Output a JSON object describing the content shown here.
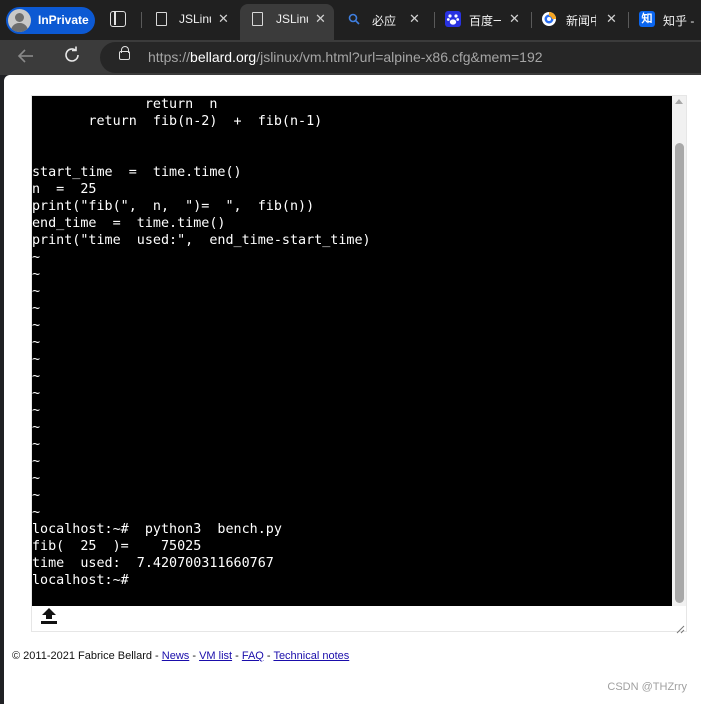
{
  "browser": {
    "inprivate_label": "InPrivate",
    "tabs": [
      {
        "label": "JSLinux",
        "active": false
      },
      {
        "label": "JSLinux",
        "active": true
      },
      {
        "label": "必应",
        "active": false
      },
      {
        "label": "百度一",
        "active": false
      },
      {
        "label": "新闻中",
        "active": false
      },
      {
        "label": "知乎 -",
        "active": false
      }
    ],
    "close_glyph": "✕",
    "icons": {
      "zhihu_badge": "知"
    },
    "address": {
      "prefix": "https://",
      "host": "bellard.org",
      "path": "/jslinux/vm.html?url=alpine-x86.cfg&mem=192"
    }
  },
  "terminal": {
    "lines": [
      "              return  n",
      "       return  fib(n-2)  +  fib(n-1)",
      "",
      "",
      "start_time  =  time.time()",
      "n  =  25",
      "print(\"fib(\",  n,  \")=  \",  fib(n))",
      "end_time  =  time.time()",
      "print(\"time  used:\",  end_time-start_time)",
      "~",
      "~",
      "~",
      "~",
      "~",
      "~",
      "~",
      "~",
      "~",
      "~",
      "~",
      "~",
      "~",
      "~",
      "~",
      "~",
      "localhost:~#  python3  bench.py",
      "fib(  25  )=    75025",
      "time  used:  7.420700311660767",
      "localhost:~#"
    ]
  },
  "footer": {
    "copyright": "© 2011-2021 Fabrice Bellard - ",
    "links": [
      "News",
      "VM list",
      "FAQ",
      "Technical notes"
    ],
    "separator": " - "
  },
  "watermark": "CSDN @THZrry",
  "colors": {
    "inprivate": "#0c59d3",
    "terminal_bg": "#000000",
    "terminal_fg": "#ffffff",
    "link": "#1a0dab"
  }
}
